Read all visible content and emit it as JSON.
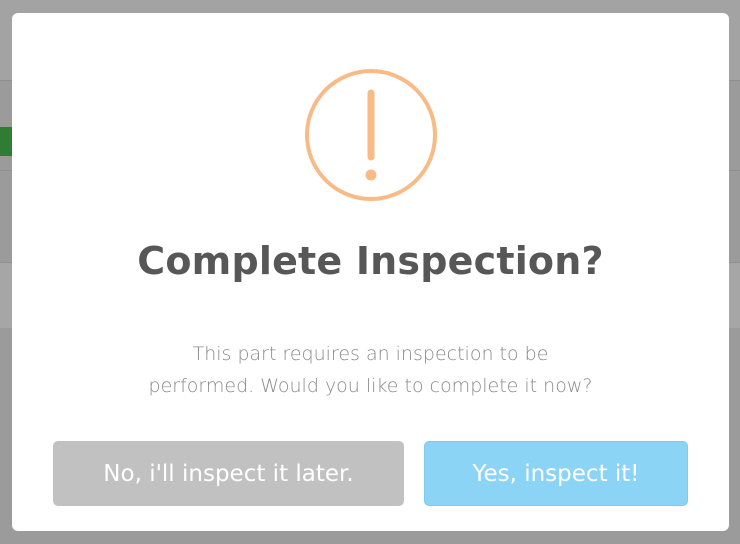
{
  "dialog": {
    "title": "Complete Inspection?",
    "message_line1": "This part requires an inspection to be",
    "message_line2": "performed. Would you like to complete it now?",
    "icon": "warning-exclamation-icon",
    "icon_color": "#f8bb86",
    "cancel_label": "No, i'll inspect it later.",
    "confirm_label": "Yes, inspect it!",
    "cancel_color": "#c1c1c1",
    "confirm_color": "#8cd4f5"
  }
}
